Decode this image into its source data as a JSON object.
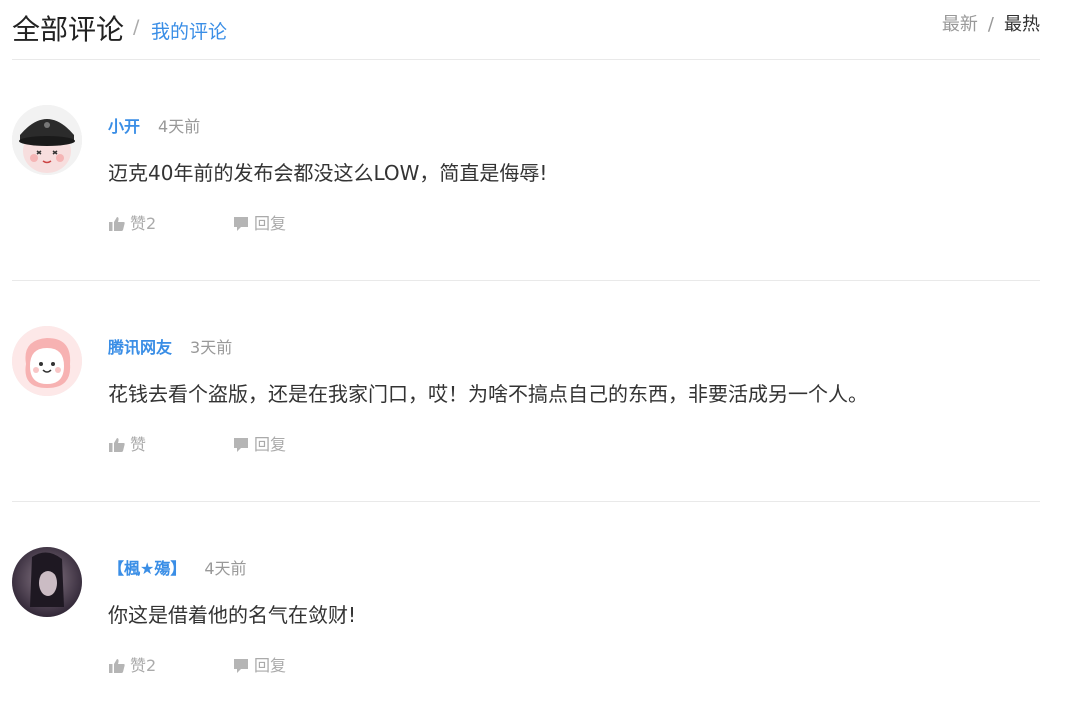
{
  "header": {
    "title": "全部评论",
    "separator": "/",
    "my_comments": "我的评论",
    "sort_newest": "最新",
    "sort_separator": "/",
    "sort_hottest": "最热"
  },
  "comments": [
    {
      "user": "小开",
      "time": "4天前",
      "text": "迈克40年前的发布会都没这么LOW，简直是侮辱!",
      "like_label": "赞2",
      "reply_label": "回复",
      "avatar_icon": "cartoon-cap-avatar"
    },
    {
      "user": "腾讯网友",
      "time": "3天前",
      "text": "花钱去看个盗版，还是在我家门口，哎！为啥不搞点自己的东西，非要活成另一个人。",
      "like_label": "赞",
      "reply_label": "回复",
      "avatar_icon": "pink-blob-avatar"
    },
    {
      "user": "【楓★殤】",
      "time": "4天前",
      "text": "你这是借着他的名气在敛财!",
      "like_label": "赞2",
      "reply_label": "回复",
      "avatar_icon": "photo-avatar"
    }
  ],
  "colors": {
    "accent": "#3a8ee6",
    "text": "#333333",
    "muted": "#999999",
    "divider": "#e9e9e9"
  }
}
